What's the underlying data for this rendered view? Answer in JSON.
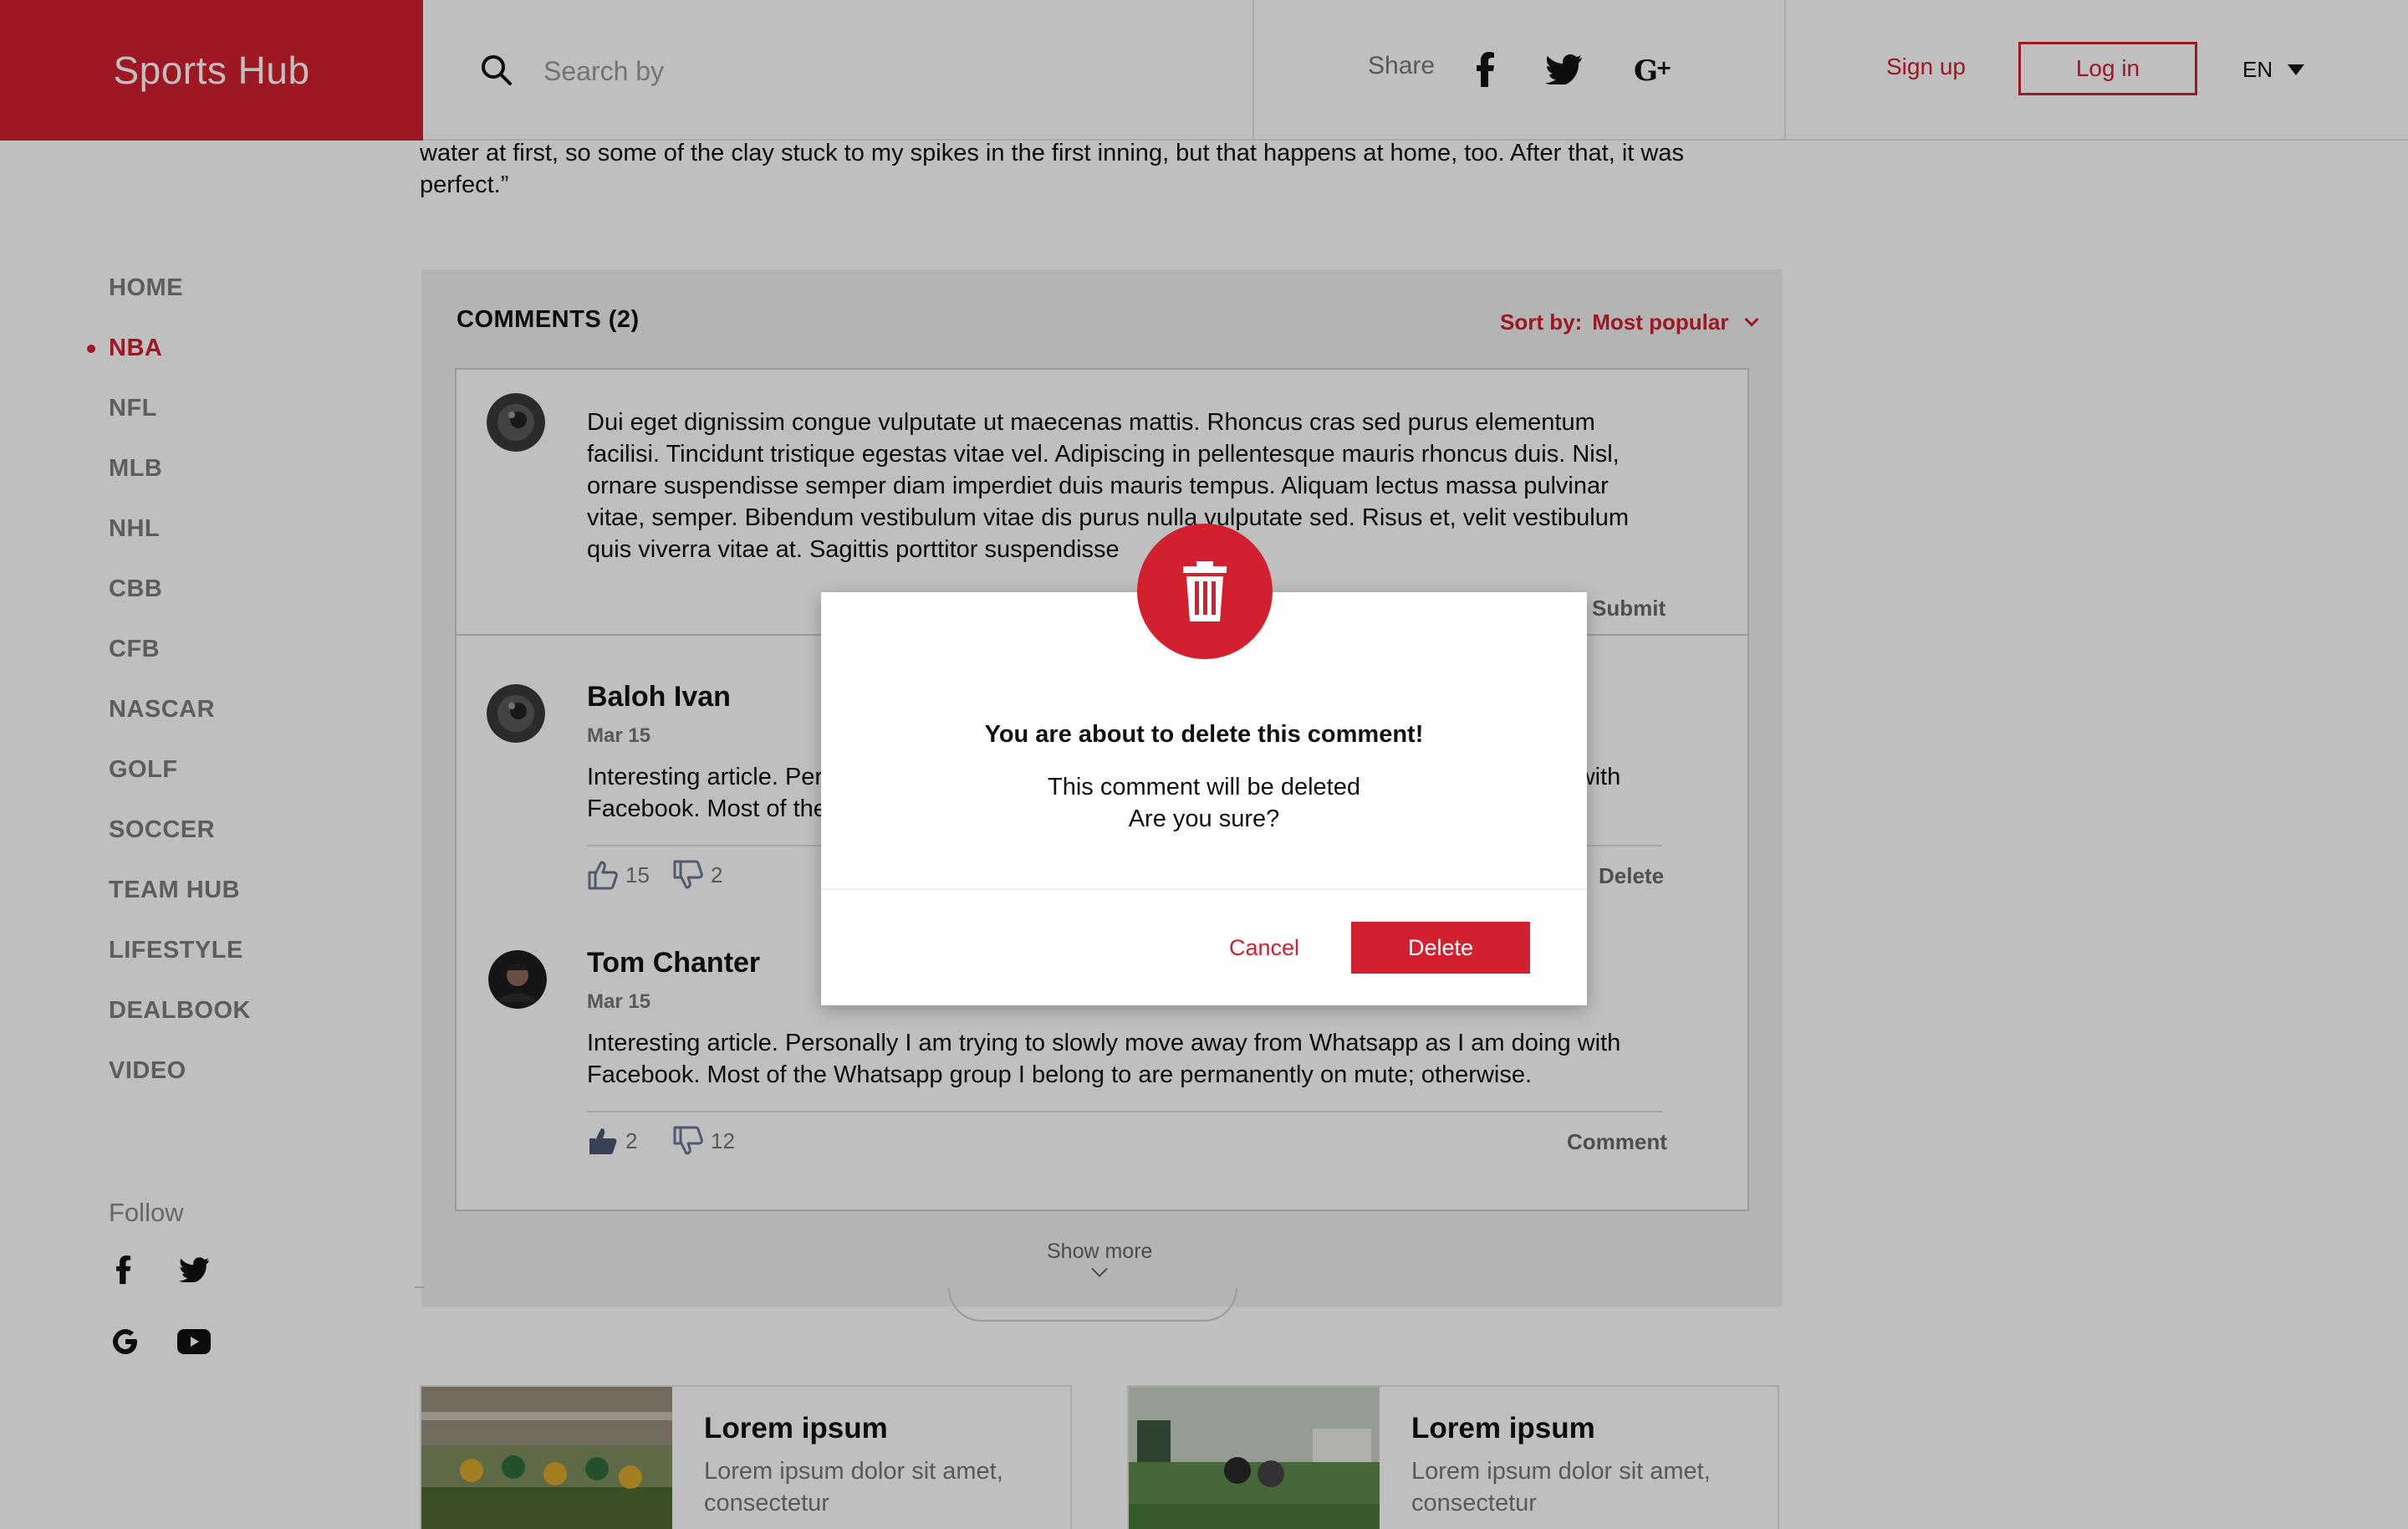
{
  "header": {
    "logo": "Sports Hub",
    "search_placeholder": "Search by",
    "share_label": "Share",
    "signup_label": "Sign up",
    "login_label": "Log in",
    "language": "EN"
  },
  "sidebar": {
    "items": [
      {
        "label": "HOME"
      },
      {
        "label": "NBA",
        "active": true
      },
      {
        "label": "NFL"
      },
      {
        "label": "MLB"
      },
      {
        "label": "NHL"
      },
      {
        "label": "CBB"
      },
      {
        "label": "CFB"
      },
      {
        "label": "NASCAR"
      },
      {
        "label": "GOLF"
      },
      {
        "label": "SOCCER"
      },
      {
        "label": "TEAM HUB"
      },
      {
        "label": "LIFESTYLE"
      },
      {
        "label": "DEALBOOK"
      },
      {
        "label": "VIDEO"
      }
    ],
    "follow_label": "Follow"
  },
  "article": {
    "tail_text": "water at first, so some of the clay stuck to my spikes in the first inning, but that happens at home, too. After that, it was perfect.”"
  },
  "comments": {
    "title": "COMMENTS (2)",
    "sort_label": "Sort by:",
    "sort_value": "Most popular",
    "draft_text": "Dui eget dignissim congue vulputate ut maecenas mattis. Rhoncus cras sed purus elementum facilisi. Tincidunt tristique egestas vitae vel. Adipiscing in pellentesque mauris rhoncus duis. Nisl, ornare suspendisse semper diam imperdiet duis mauris tempus. Aliquam lectus massa pulvinar vitae, semper. Bibendum vestibulum vitae dis purus nulla vulputate sed. Risus et, velit vestibulum quis viverra vitae at. Sagittis porttitor suspendisse",
    "submit_label": "Submit",
    "items": [
      {
        "author": "Baloh Ivan",
        "date": "Mar 15",
        "text": "Interesting article. Personally I am trying to slowly move away from Whatsapp as I am doing with Facebook. Most of the Whatsapp group I belong to are permanently on mute; otherwise.",
        "likes": "15",
        "dislikes": "2",
        "action": "Delete"
      },
      {
        "author": "Tom Chanter",
        "date": "Mar 15",
        "text": "Interesting article. Personally I am trying to slowly move away from Whatsapp as I am doing with Facebook. Most of the Whatsapp group I belong to are permanently on mute; otherwise.",
        "likes": "2",
        "dislikes": "12",
        "action": "Comment"
      }
    ],
    "show_more": "Show more"
  },
  "cards": [
    {
      "title": "Lorem ipsum",
      "desc": "Lorem ipsum dolor sit amet, consectetur"
    },
    {
      "title": "Lorem ipsum",
      "desc": "Lorem ipsum dolor sit amet, consectetur"
    }
  ],
  "modal": {
    "title": "You are about to delete this comment!",
    "line1": "This comment will be deleted",
    "line2": "Are you sure?",
    "cancel_label": "Cancel",
    "delete_label": "Delete"
  },
  "colors": {
    "accent": "#d2202f",
    "overlay": "rgba(0,0,0,0.25)"
  }
}
